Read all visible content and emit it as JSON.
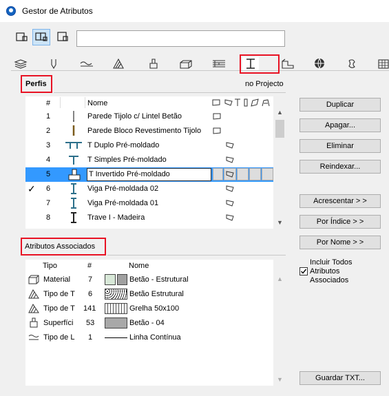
{
  "window": {
    "title": "Gestor de Atributos"
  },
  "toolbar": {
    "search_value": ""
  },
  "perfis": {
    "title": "Perfis",
    "scope_label": "no Projecto",
    "columns": {
      "num": "#",
      "name": "Nome"
    },
    "rows": [
      {
        "num": "1",
        "name": "Parede Tijolo c/ Lintel Betão",
        "checked": false,
        "selected": false
      },
      {
        "num": "2",
        "name": "Parede Bloco Revestimento Tijolo",
        "checked": false,
        "selected": false
      },
      {
        "num": "3",
        "name": "T Duplo Pré-moldado",
        "checked": false,
        "selected": false
      },
      {
        "num": "4",
        "name": "T Simples Pré-moldado",
        "checked": false,
        "selected": false
      },
      {
        "num": "5",
        "name": "T Invertido Pré-moldado",
        "checked": false,
        "selected": true
      },
      {
        "num": "6",
        "name": "Viga Pré-moldada 02",
        "checked": true,
        "selected": false
      },
      {
        "num": "7",
        "name": "Viga Pré-moldada 01",
        "checked": false,
        "selected": false
      },
      {
        "num": "8",
        "name": "Trave I - Madeira",
        "checked": false,
        "selected": false
      }
    ],
    "check_mark": "✓"
  },
  "buttons": {
    "duplicar": "Duplicar",
    "apagar": "Apagar...",
    "eliminar": "Eliminar",
    "reindexar": "Reindexar...",
    "acrescentar": "Acrescentar > >",
    "por_indice": "Por Índice > >",
    "por_nome": "Por Nome > >",
    "guardar_txt": "Guardar TXT..."
  },
  "associados": {
    "title": "Atributos Associados",
    "columns": {
      "tipo": "Tipo",
      "num": "#",
      "name": "Nome"
    },
    "rows": [
      {
        "tipo": "Material",
        "num": "7",
        "name": "Betão - Estrutural"
      },
      {
        "tipo": "Tipo de T",
        "num": "6",
        "name": "Betão Estrutural"
      },
      {
        "tipo": "Tipo de T",
        "num": "141",
        "name": "Grelha 50x100"
      },
      {
        "tipo": "Superfíci",
        "num": "53",
        "name": "Betão - 04"
      },
      {
        "tipo": "Tipo de L",
        "num": "1",
        "name": "Linha Contínua"
      }
    ],
    "include_all_label_1": "Incluir Todos",
    "include_all_label_2": "Atributos",
    "include_all_label_3": "Associados",
    "include_all_checked": true
  },
  "colors": {
    "highlight": "#e81123",
    "selection": "#3399ff",
    "accent": "#1565c0"
  }
}
